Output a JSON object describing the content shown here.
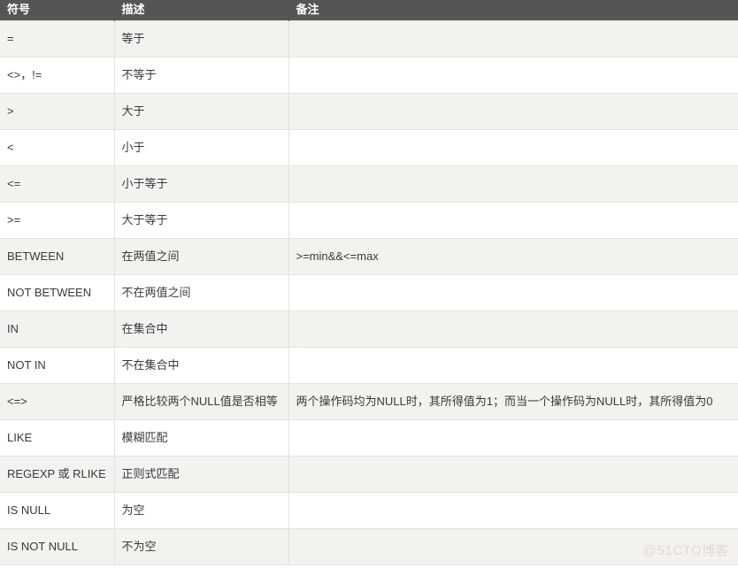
{
  "table": {
    "headers": [
      "符号",
      "描述",
      "备注"
    ],
    "rows": [
      {
        "symbol": "=",
        "description": "等于",
        "remark": ""
      },
      {
        "symbol": "<>，!=",
        "description": "不等于",
        "remark": ""
      },
      {
        "symbol": ">",
        "description": "大于",
        "remark": ""
      },
      {
        "symbol": "<",
        "description": "小于",
        "remark": ""
      },
      {
        "symbol": "<=",
        "description": "小于等于",
        "remark": ""
      },
      {
        "symbol": ">=",
        "description": "大于等于",
        "remark": ""
      },
      {
        "symbol": "BETWEEN",
        "description": "在两值之间",
        "remark": ">=min&&<=max"
      },
      {
        "symbol": "NOT BETWEEN",
        "description": "不在两值之间",
        "remark": ""
      },
      {
        "symbol": "IN",
        "description": "在集合中",
        "remark": ""
      },
      {
        "symbol": "NOT IN",
        "description": "不在集合中",
        "remark": ""
      },
      {
        "symbol": "<=>",
        "description": "严格比较两个NULL值是否相等",
        "remark": "两个操作码均为NULL时，其所得值为1；而当一个操作码为NULL时，其所得值为0"
      },
      {
        "symbol": "LIKE",
        "description": "模糊匹配",
        "remark": ""
      },
      {
        "symbol": "REGEXP 或 RLIKE",
        "description": "正则式匹配",
        "remark": ""
      },
      {
        "symbol": "IS NULL",
        "description": "为空",
        "remark": ""
      },
      {
        "symbol": "IS NOT NULL",
        "description": "不为空",
        "remark": ""
      }
    ]
  },
  "watermark": {
    "text": "@51CTO博客"
  },
  "colors": {
    "header_background": "#555555",
    "header_text": "#ffffff",
    "stripe_row": "#f4f2ef",
    "plain_row": "#ffffff",
    "border": "#e4e2de",
    "body_text": "#3a3a3a",
    "watermark_text": "#dedad5"
  }
}
